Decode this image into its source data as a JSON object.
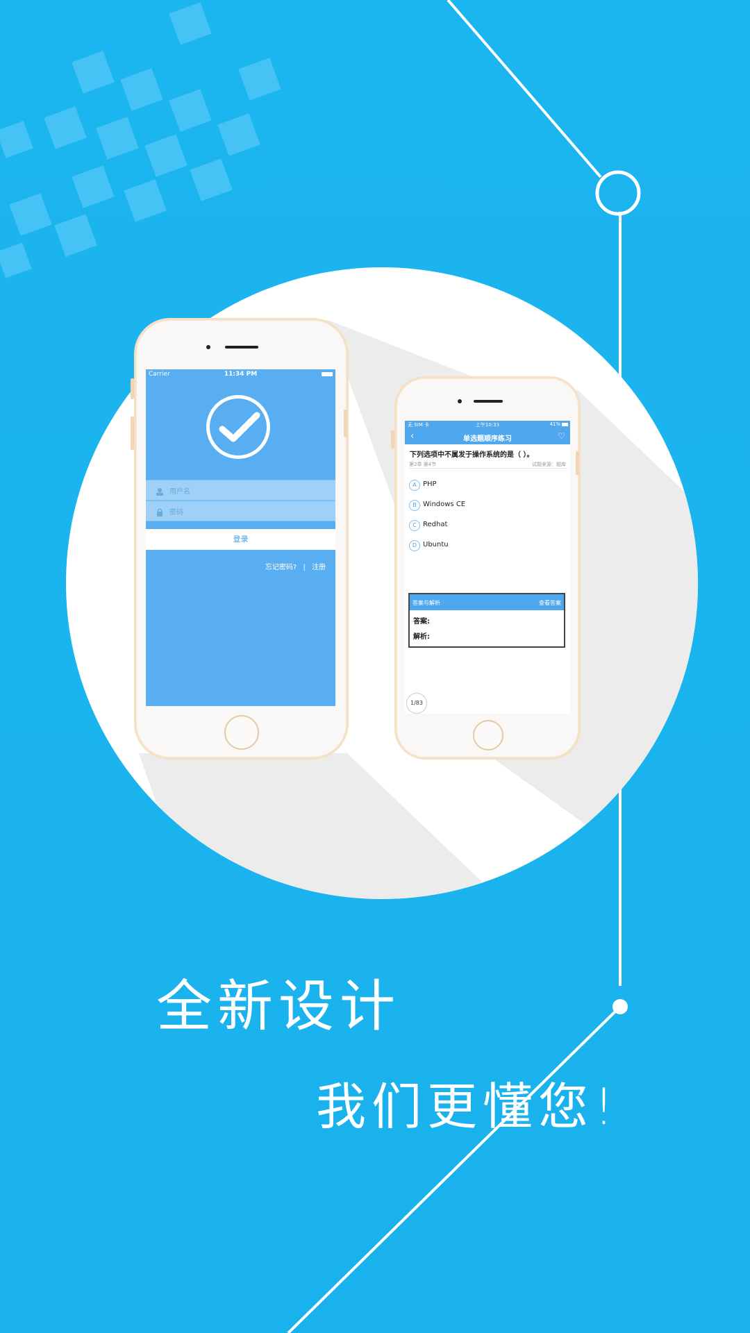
{
  "theme": {
    "bg": "#1bb5ef",
    "accent": "#4fa7ee",
    "white": "#ffffff"
  },
  "phone_login": {
    "status": {
      "carrier": "Carrier",
      "time": "11:34 PM"
    },
    "logo": "checkmark-circle-icon",
    "username_placeholder": "用户名",
    "password_placeholder": "密码",
    "login_label": "登录",
    "forgot_label": "忘记密码?",
    "separator": "|",
    "register_label": "注册"
  },
  "phone_quiz": {
    "status": {
      "left": "无 SIM 卡",
      "time": "上午10:33",
      "battery": "41%"
    },
    "title": "单选题顺序练习",
    "question": "下列选项中不属发于操作系统的是（ ）。",
    "meta_left": "第2章 第4节",
    "meta_right": "试题来源：题库",
    "options": [
      {
        "letter": "A",
        "text": "PHP"
      },
      {
        "letter": "B",
        "text": "Windows CE"
      },
      {
        "letter": "C",
        "text": "Redhat"
      },
      {
        "letter": "D",
        "text": "Ubuntu"
      }
    ],
    "answer_header": "答案与解析",
    "view_answer": "查看答案",
    "answer_label": "答案:",
    "analysis_label": "解析:",
    "pager": "1/83"
  },
  "slogan": {
    "line1": "全新设计",
    "line2": "我们更懂您!"
  }
}
